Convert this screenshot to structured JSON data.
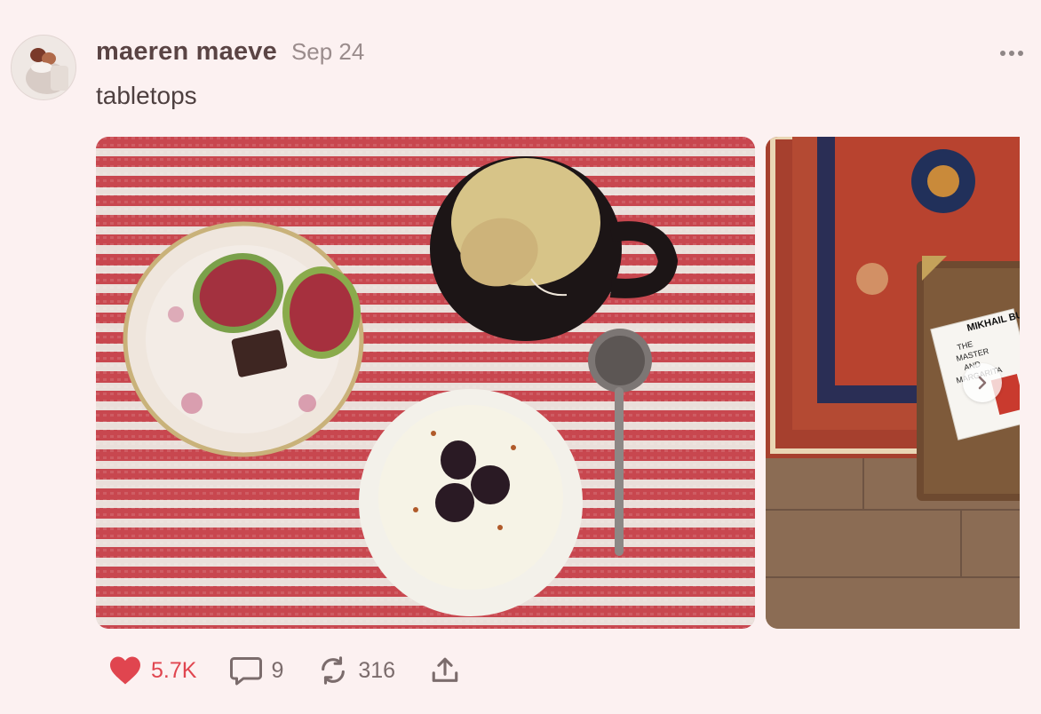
{
  "post": {
    "author": "maeren maeve",
    "date": "Sep 24",
    "text": "tabletops"
  },
  "media": {
    "images": [
      {
        "icon": "tabletop-photo-figs-yogurt-tea"
      },
      {
        "icon": "tabletop-photo-rug-book"
      }
    ],
    "book_cover_lines": [
      "THE",
      "MASTER",
      "AND",
      "MARGARITA"
    ],
    "book_spine_text": "MIKHAIL BU"
  },
  "actions": {
    "likes": "5.7K",
    "comments": "9",
    "reposts": "316"
  },
  "colors": {
    "background": "#fcf1f1",
    "like": "#e0454f",
    "muted": "#8f8686"
  }
}
